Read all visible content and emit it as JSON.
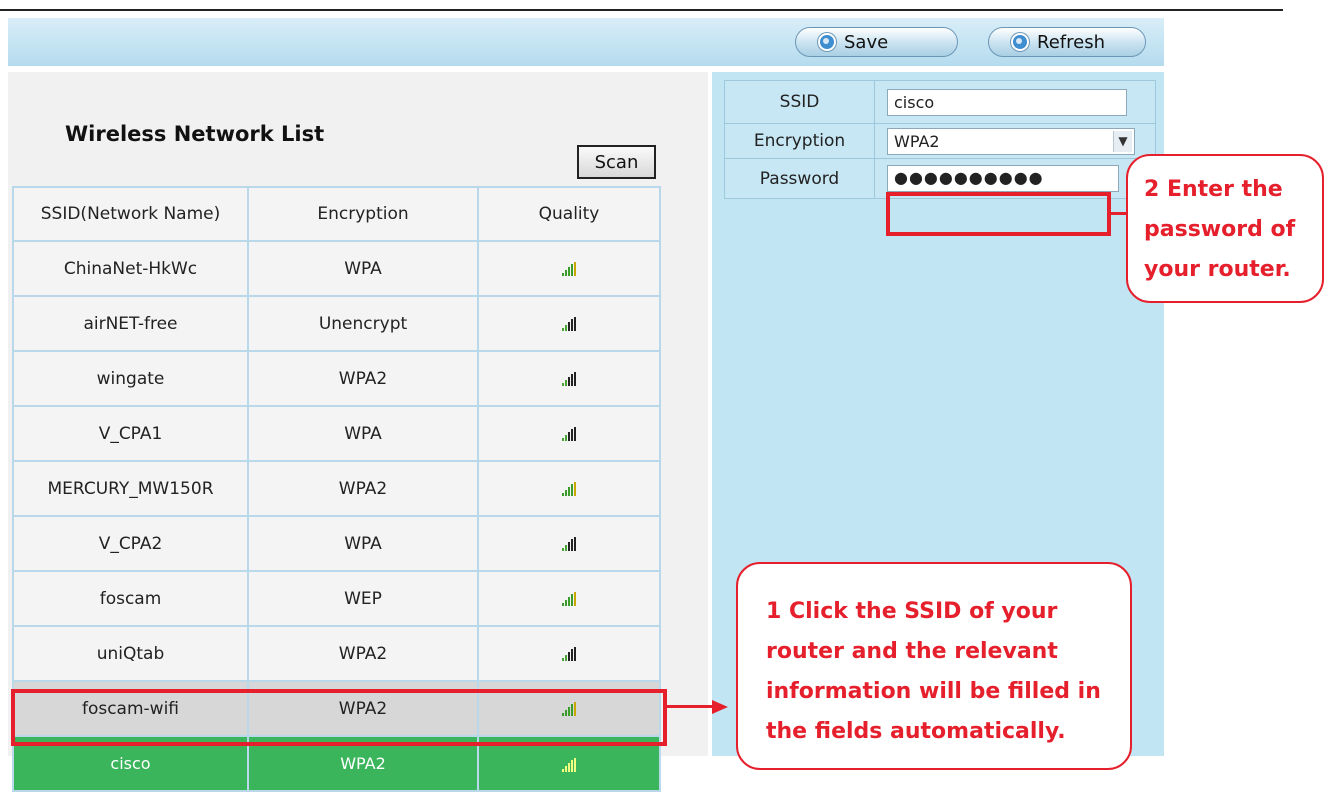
{
  "toolbar": {
    "save_label": "Save",
    "refresh_label": "Refresh"
  },
  "network_list": {
    "title": "Wireless Network List",
    "scan_label": "Scan",
    "columns": [
      "SSID(Network Name)",
      "Encryption",
      "Quality"
    ],
    "rows": [
      {
        "ssid": "ChinaNet-HkWc",
        "encryption": "WPA",
        "quality": "good"
      },
      {
        "ssid": "airNET-free",
        "encryption": "Unencrypt",
        "quality": "fair"
      },
      {
        "ssid": "wingate",
        "encryption": "WPA2",
        "quality": "fair"
      },
      {
        "ssid": "V_CPA1",
        "encryption": "WPA",
        "quality": "fair"
      },
      {
        "ssid": "MERCURY_MW150R",
        "encryption": "WPA2",
        "quality": "good"
      },
      {
        "ssid": "V_CPA2",
        "encryption": "WPA",
        "quality": "fair"
      },
      {
        "ssid": "foscam",
        "encryption": "WEP",
        "quality": "good"
      },
      {
        "ssid": "uniQtab",
        "encryption": "WPA2",
        "quality": "fair"
      },
      {
        "ssid": "foscam-wifi",
        "encryption": "WPA2",
        "quality": "good"
      },
      {
        "ssid": "cisco",
        "encryption": "WPA2",
        "quality": "good"
      }
    ],
    "hovered_index": 8,
    "selected_index": 9
  },
  "form": {
    "ssid_label": "SSID",
    "ssid_value": "cisco",
    "encryption_label": "Encryption",
    "encryption_value": "WPA2",
    "password_label": "Password",
    "password_value": "●●●●●●●●●●"
  },
  "callouts": {
    "step1": "1 Click the SSID of your router and the relevant information will be filled in the fields automatically.",
    "step2": "2 Enter the password of your router."
  },
  "colors": {
    "highlight": "#e5202c",
    "selected_row": "#3bb55b",
    "hover_row": "#d7d7d7",
    "panel_blue": "#c1e5f2"
  }
}
